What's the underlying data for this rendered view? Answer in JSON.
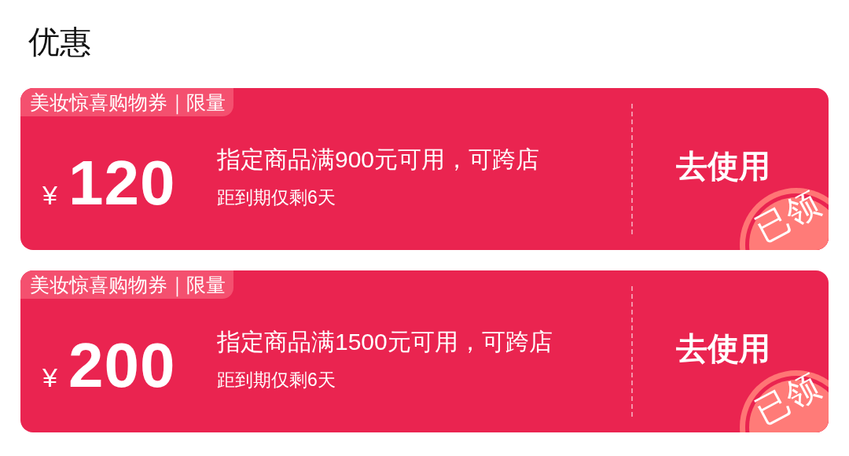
{
  "title": "优惠",
  "coupons": [
    {
      "tag": "美妆惊喜购物券｜限量",
      "currency": "¥",
      "amount": "120",
      "condition": "指定商品满900元可用，可跨店",
      "expiry": "距到期仅剩6天",
      "action": "去使用",
      "claimed": true,
      "stamp": "已领"
    },
    {
      "tag": "美妆惊喜购物券｜限量",
      "currency": "¥",
      "amount": "200",
      "condition": "指定商品满1500元可用，可跨店",
      "expiry": "距到期仅剩6天",
      "action": "去使用",
      "claimed": true,
      "stamp": "已领"
    }
  ]
}
